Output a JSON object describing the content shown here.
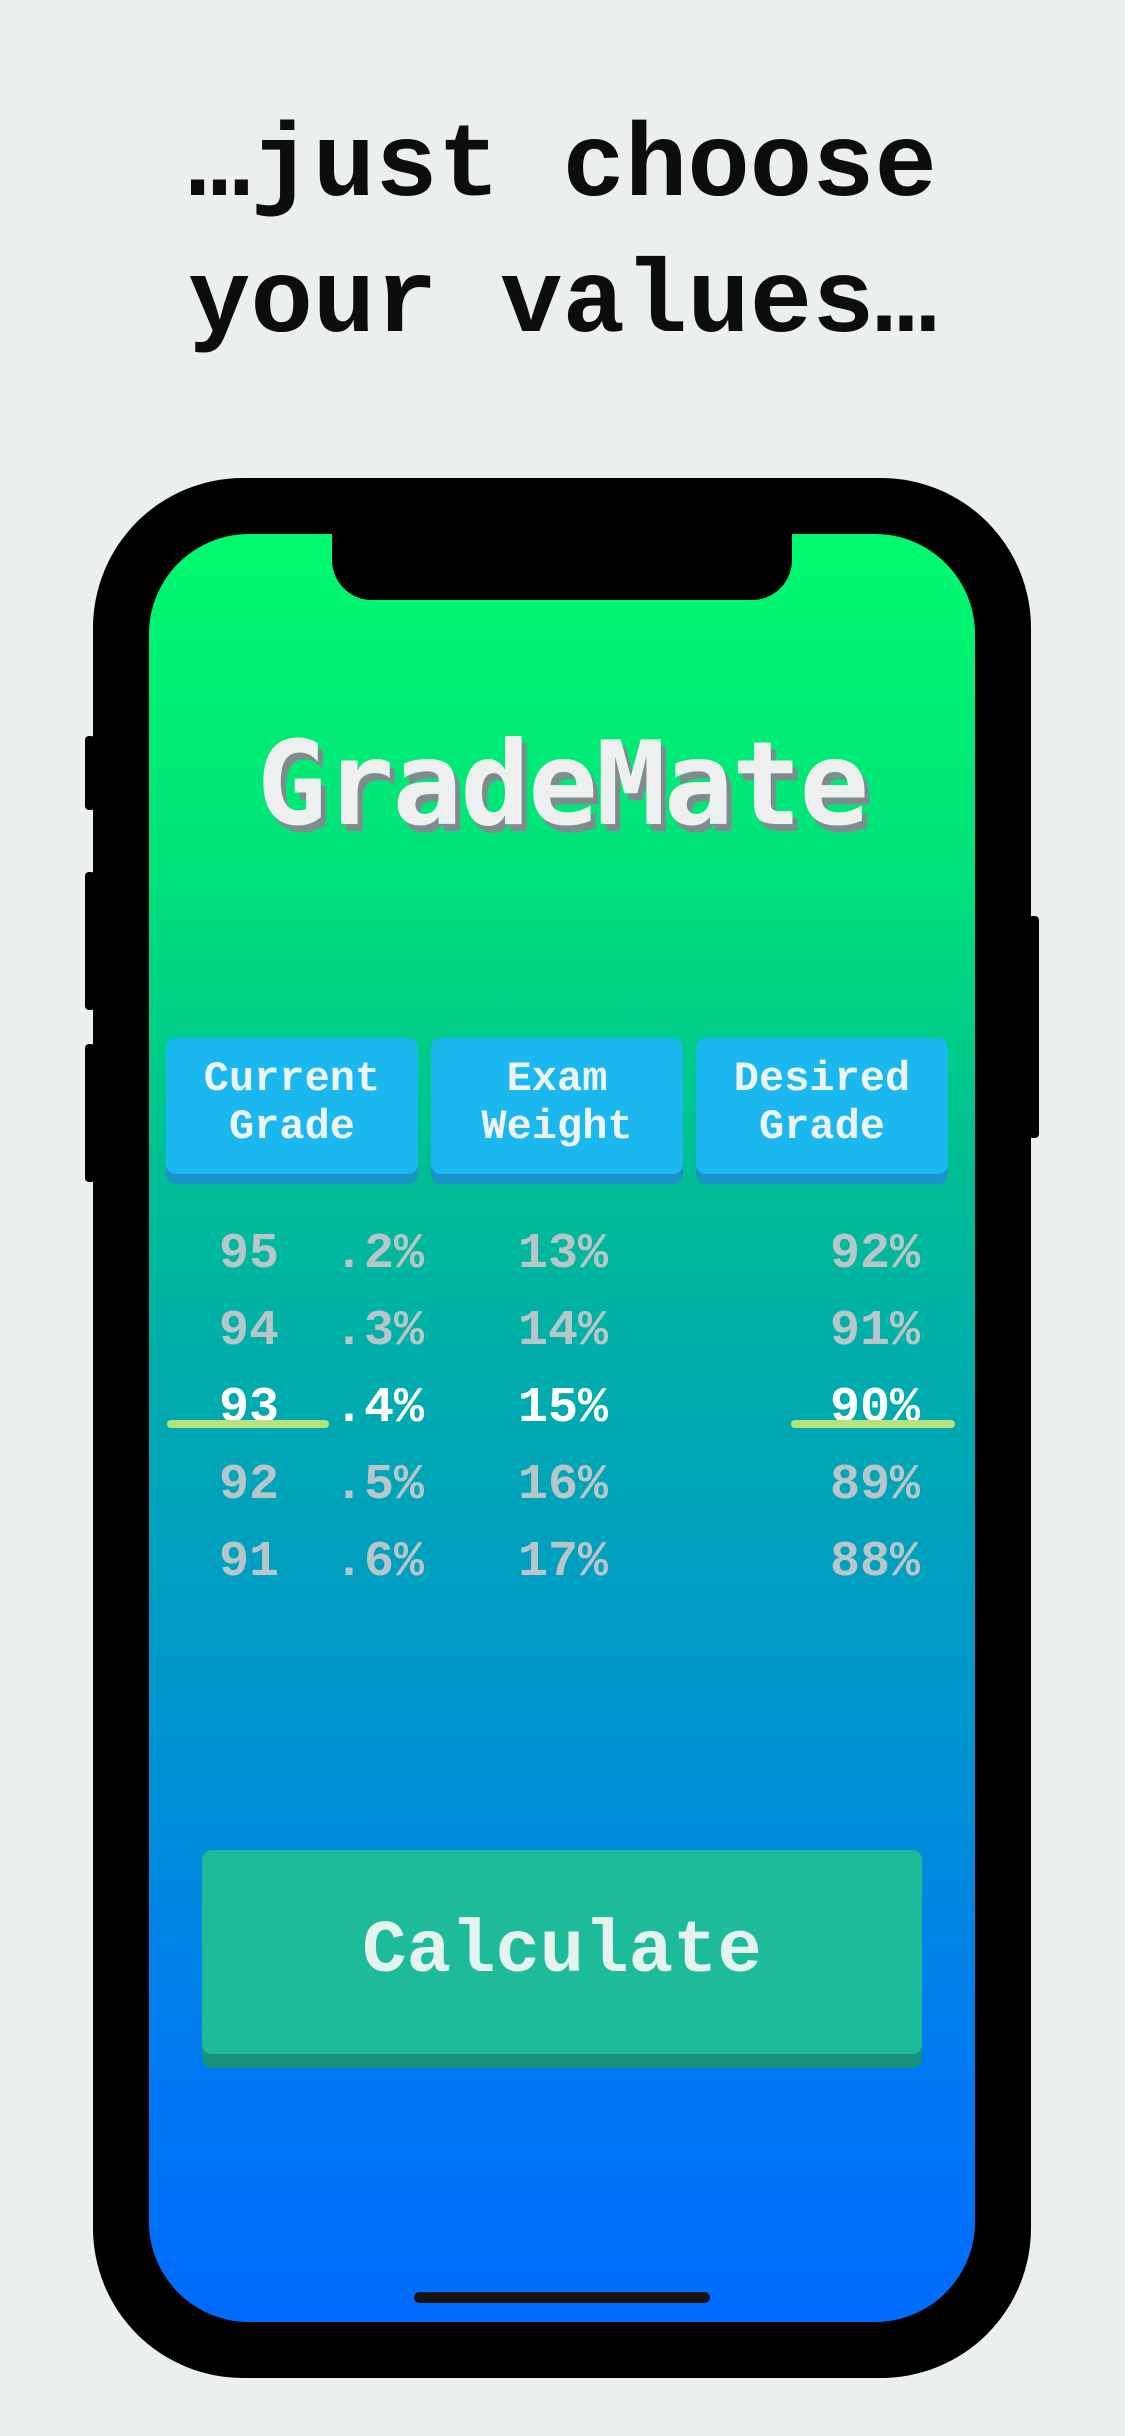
{
  "headline": {
    "line1": "…just choose",
    "line2": "your values…"
  },
  "app": {
    "title": "GradeMate",
    "columns": [
      {
        "line1": "Current",
        "line2": "Grade"
      },
      {
        "line1": "Exam",
        "line2": "Weight"
      },
      {
        "line1": "Desired",
        "line2": "Grade"
      }
    ],
    "pickers": {
      "current_whole": [
        "95",
        "94",
        "93",
        "92",
        "91"
      ],
      "current_decimal": [
        ".2%",
        ".3%",
        ".4%",
        ".5%",
        ".6%"
      ],
      "exam_weight": [
        "13%",
        "14%",
        "15%",
        "16%",
        "17%"
      ],
      "desired": [
        "92%",
        "91%",
        "90%",
        "89%",
        "88%"
      ]
    },
    "selected": {
      "current_whole": "93",
      "current_decimal": ".4%",
      "exam_weight": "15%",
      "desired": "90%"
    },
    "calculate_label": "Calculate"
  },
  "colors": {
    "background": "#eceff0",
    "column_button": "#1ab8ee",
    "calculate_button": "#1ebb9b",
    "selection_line": "#b8e27a",
    "gradient_top": "#00fa6e",
    "gradient_bottom": "#006cff"
  }
}
